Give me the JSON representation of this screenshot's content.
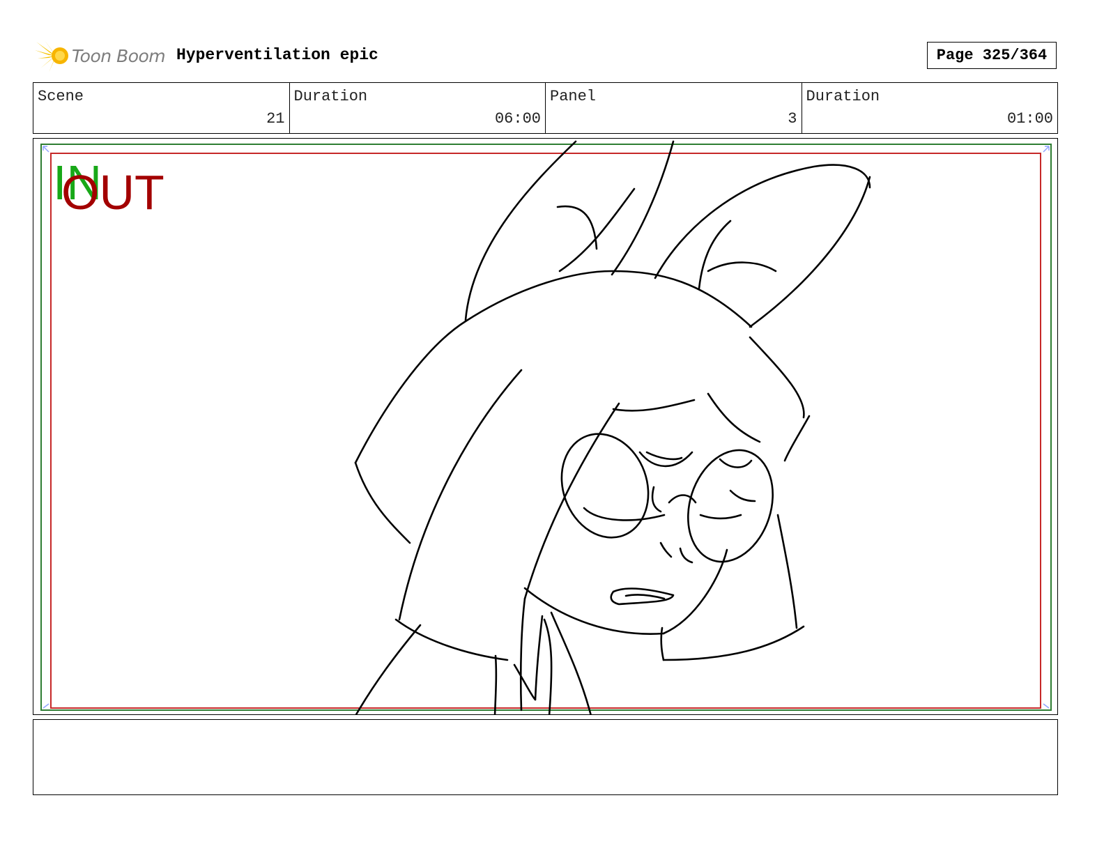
{
  "header": {
    "logo_text": "Toon Boom",
    "project_title": "Hyperventilation epic",
    "page_label": "Page 325/364"
  },
  "info": {
    "scene_label": "Scene",
    "scene_value": "21",
    "scene_duration_label": "Duration",
    "scene_duration_value": "06:00",
    "panel_label": "Panel",
    "panel_value": "3",
    "panel_duration_label": "Duration",
    "panel_duration_value": "01:00"
  },
  "panel": {
    "in_marker": "IN",
    "out_marker": "OUT",
    "colors": {
      "in_marker": "#18a818",
      "out_marker": "#a30000",
      "safe_frame_outer": "#2e7d32",
      "safe_frame_inner": "#c62828",
      "sketch_line": "#000000"
    }
  },
  "notes": {
    "text": ""
  }
}
